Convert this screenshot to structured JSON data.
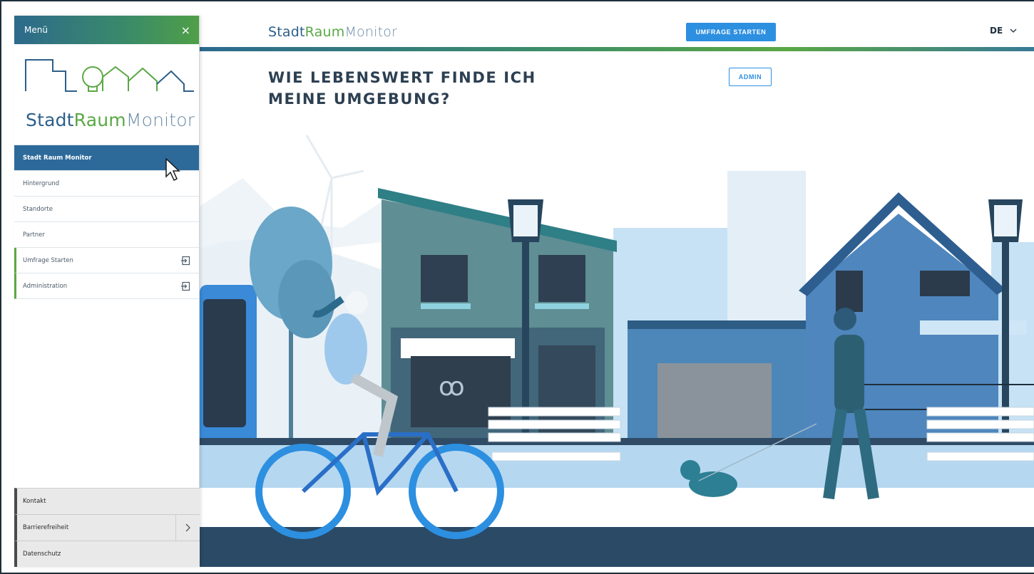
{
  "header": {
    "brand": {
      "part1": "Stadt",
      "part2": "Raum",
      "part3": "Monitor"
    },
    "start_button": "UMFRAGE STARTEN",
    "language": "DE",
    "language_chevron": "chevron-down-icon"
  },
  "hero": {
    "title_line1": "WIE LEBENSWERT FINDE ICH",
    "title_line2": "MEINE UMGEBUNG?",
    "admin_button": "ADMIN"
  },
  "menu": {
    "title": "Menü",
    "close_symbol": "×",
    "logo": {
      "part1": "Stadt",
      "part2": "Raum",
      "part3": "Monitor"
    },
    "items": [
      {
        "label": "Stadt Raum Monitor"
      },
      {
        "label": "Hintergrund"
      },
      {
        "label": "Standorte"
      },
      {
        "label": "Partner"
      },
      {
        "label": "Umfrage Starten",
        "icon": "external-link-icon"
      },
      {
        "label": "Administration",
        "icon": "external-link-icon"
      }
    ],
    "footer": [
      {
        "label": "Kontakt"
      },
      {
        "label": "Barrierefreiheit",
        "icon": "chevron-right-icon"
      },
      {
        "label": "Datenschutz"
      }
    ]
  },
  "colors": {
    "brand_blue": "#2c5f8a",
    "brand_green": "#5aa845",
    "button_blue": "#2d8fe0",
    "menu_active": "#2d6a9a"
  }
}
